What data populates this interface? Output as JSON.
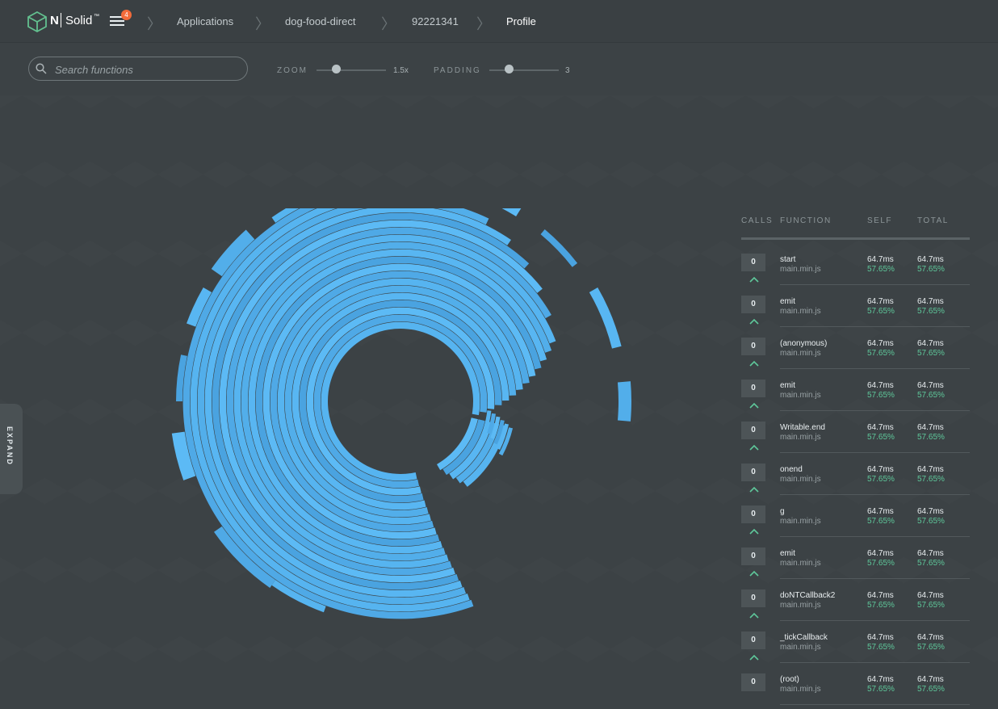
{
  "app": {
    "brand_n": "N",
    "brand_name": "Solid",
    "brand_tm": "™"
  },
  "header": {
    "menu_badge": "4",
    "breadcrumbs": [
      "Applications",
      "dog-food-direct",
      "92221341",
      "Profile"
    ]
  },
  "toolbar": {
    "search_placeholder": "Search functions",
    "zoom": {
      "label": "ZOOM",
      "value_text": "1.5x",
      "fraction": 0.29
    },
    "padding": {
      "label": "PADDING",
      "value_text": "3",
      "fraction": 0.29
    }
  },
  "sidebar": {
    "expand_label": "EXPAND"
  },
  "colors": {
    "accent": "#56b4f0",
    "percent": "#5ec79a",
    "badge": "#f26b3a"
  },
  "icons": [
    "nsolid-cube-icon",
    "menu-icon",
    "search-icon",
    "chevron-right-icon",
    "chevron-up-icon"
  ],
  "table": {
    "headers": [
      "CALLS",
      "FUNCTION",
      "SELF",
      "TOTAL"
    ],
    "rows": [
      {
        "calls": "0",
        "name": "start",
        "file": "main.min.js",
        "self_ms": "64.7ms",
        "self_pct": "57.65%",
        "total_ms": "64.7ms",
        "total_pct": "57.65%"
      },
      {
        "calls": "0",
        "name": "emit",
        "file": "main.min.js",
        "self_ms": "64.7ms",
        "self_pct": "57.65%",
        "total_ms": "64.7ms",
        "total_pct": "57.65%"
      },
      {
        "calls": "0",
        "name": "(anonymous)",
        "file": "main.min.js",
        "self_ms": "64.7ms",
        "self_pct": "57.65%",
        "total_ms": "64.7ms",
        "total_pct": "57.65%"
      },
      {
        "calls": "0",
        "name": "emit",
        "file": "main.min.js",
        "self_ms": "64.7ms",
        "self_pct": "57.65%",
        "total_ms": "64.7ms",
        "total_pct": "57.65%"
      },
      {
        "calls": "0",
        "name": "Writable.end",
        "file": "main.min.js",
        "self_ms": "64.7ms",
        "self_pct": "57.65%",
        "total_ms": "64.7ms",
        "total_pct": "57.65%"
      },
      {
        "calls": "0",
        "name": "onend",
        "file": "main.min.js",
        "self_ms": "64.7ms",
        "self_pct": "57.65%",
        "total_ms": "64.7ms",
        "total_pct": "57.65%"
      },
      {
        "calls": "0",
        "name": "g",
        "file": "main.min.js",
        "self_ms": "64.7ms",
        "self_pct": "57.65%",
        "total_ms": "64.7ms",
        "total_pct": "57.65%"
      },
      {
        "calls": "0",
        "name": "emit",
        "file": "main.min.js",
        "self_ms": "64.7ms",
        "self_pct": "57.65%",
        "total_ms": "64.7ms",
        "total_pct": "57.65%"
      },
      {
        "calls": "0",
        "name": "doNTCallback2",
        "file": "main.min.js",
        "self_ms": "64.7ms",
        "self_pct": "57.65%",
        "total_ms": "64.7ms",
        "total_pct": "57.65%"
      },
      {
        "calls": "0",
        "name": "_tickCallback",
        "file": "main.min.js",
        "self_ms": "64.7ms",
        "self_pct": "57.65%",
        "total_ms": "64.7ms",
        "total_pct": "57.65%"
      },
      {
        "calls": "0",
        "name": "(root)",
        "file": "main.min.js",
        "self_ms": "64.7ms",
        "self_pct": "57.65%",
        "total_ms": "64.7ms",
        "total_pct": "57.65%"
      }
    ]
  }
}
